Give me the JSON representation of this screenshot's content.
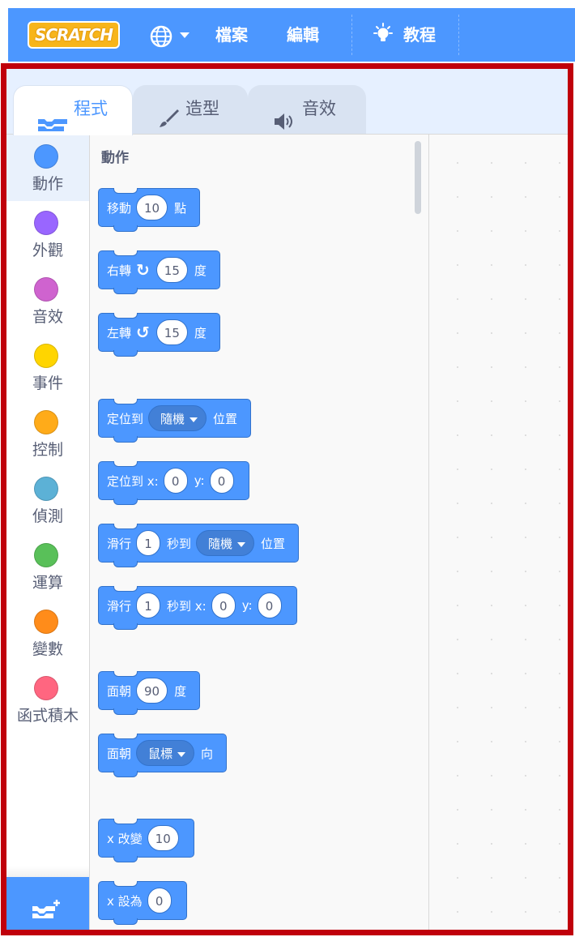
{
  "menubar": {
    "logo_text": "SCRATCH",
    "file_label": "檔案",
    "edit_label": "編輯",
    "tutorials_label": "教程"
  },
  "tabs": [
    {
      "label": "程式",
      "active": true
    },
    {
      "label": "造型",
      "active": false
    },
    {
      "label": "音效",
      "active": false
    }
  ],
  "categories": [
    {
      "label": "動作",
      "color": "#4c97ff",
      "selected": true
    },
    {
      "label": "外觀",
      "color": "#9966ff"
    },
    {
      "label": "音效",
      "color": "#cf63cf"
    },
    {
      "label": "事件",
      "color": "#ffd500"
    },
    {
      "label": "控制",
      "color": "#ffab19"
    },
    {
      "label": "偵測",
      "color": "#5cb1d6"
    },
    {
      "label": "運算",
      "color": "#59c059"
    },
    {
      "label": "變數",
      "color": "#ff8c1a"
    },
    {
      "label": "函式積木",
      "color": "#ff6680"
    }
  ],
  "palette": {
    "heading": "動作",
    "blocks": {
      "move": {
        "pre": "移動",
        "value": "10",
        "post": "點"
      },
      "turn_right": {
        "pre": "右轉",
        "icon": "↻",
        "value": "15",
        "post": "度"
      },
      "turn_left": {
        "pre": "左轉",
        "icon": "↺",
        "value": "15",
        "post": "度"
      },
      "goto": {
        "pre": "定位到",
        "dropdown": "隨機",
        "post": "位置"
      },
      "goto_xy": {
        "pre": "定位到 x:",
        "x": "0",
        "mid": "y:",
        "y": "0"
      },
      "glide": {
        "pre": "滑行",
        "secs": "1",
        "mid": "秒到",
        "dropdown": "隨機",
        "post": "位置"
      },
      "glide_xy": {
        "pre": "滑行",
        "secs": "1",
        "mid": "秒到 x:",
        "x": "0",
        "ylabel": "y:",
        "y": "0"
      },
      "point_dir": {
        "pre": "面朝",
        "value": "90",
        "post": "度"
      },
      "point_towards": {
        "pre": "面朝",
        "dropdown": "鼠標",
        "post": "向"
      },
      "change_x": {
        "pre": "x 改變",
        "value": "10"
      },
      "set_x": {
        "pre": "x 設為",
        "value": "0"
      }
    }
  }
}
